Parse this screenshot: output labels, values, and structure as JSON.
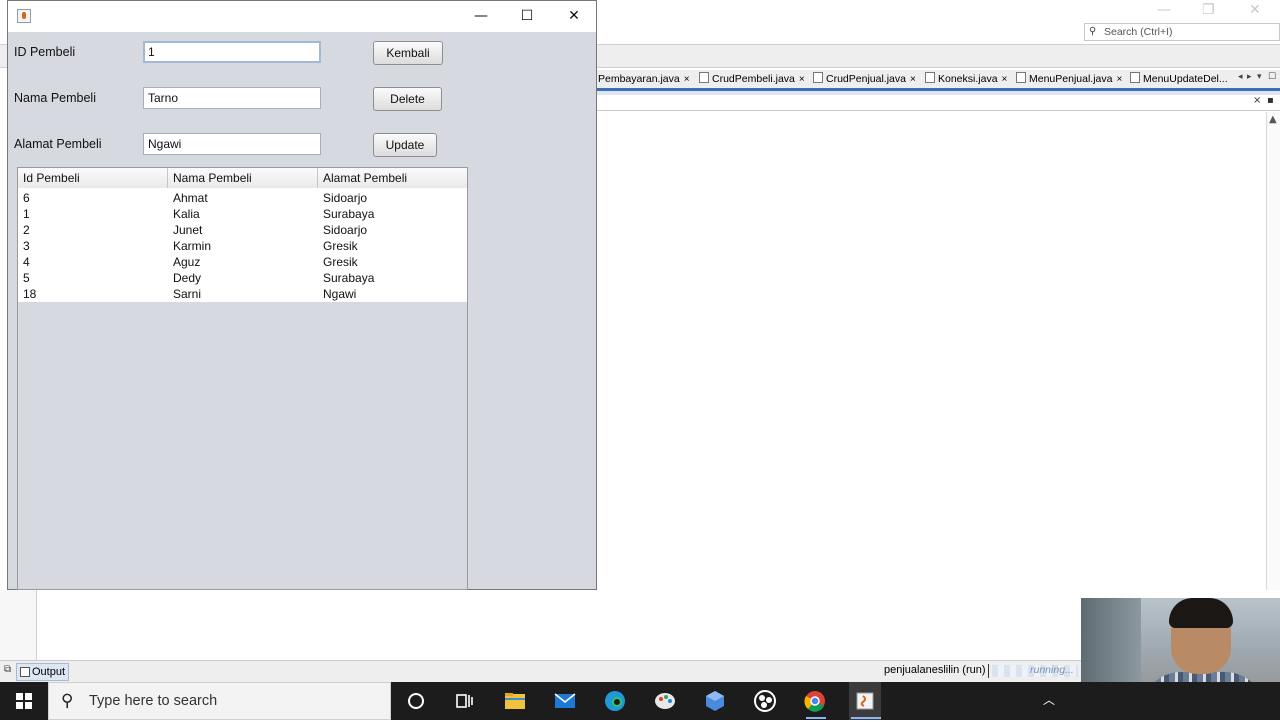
{
  "ide": {
    "search_placeholder": "Search (Ctrl+I)",
    "search_icon": "magnifier-icon",
    "tabs": [
      {
        "label": "Pembayaran.java"
      },
      {
        "label": "CrudPembeli.java"
      },
      {
        "label": "CrudPenjual.java"
      },
      {
        "label": "Koneksi.java"
      },
      {
        "label": "MenuPenjual.java"
      },
      {
        "label": "MenuUpdateDel..."
      }
    ],
    "tab_close": "×",
    "output_tab": "Output",
    "run_label": "penjualaneslilin (run)",
    "run_status": "running...",
    "accent": "#3a6fb7"
  },
  "app": {
    "window_controls": {
      "minimize": "—",
      "maximize": "☐",
      "close": "✕"
    },
    "form": {
      "id_label": "ID Pembeli",
      "id_value": "1",
      "nama_label": "Nama Pembeli",
      "nama_value": "Tarno",
      "alamat_label": "Alamat Pembeli",
      "alamat_value": "Ngawi"
    },
    "buttons": {
      "kembali": "Kembali",
      "delete": "Delete",
      "update": "Update"
    },
    "table": {
      "headers": [
        "Id Pembeli",
        "Nama Pembeli",
        "Alamat Pembeli"
      ],
      "rows": [
        [
          "6",
          "Ahmat",
          "Sidoarjo"
        ],
        [
          "1",
          "Kalia",
          "Surabaya"
        ],
        [
          "2",
          "Junet",
          "Sidoarjo"
        ],
        [
          "3",
          "Karmin",
          "Gresik"
        ],
        [
          "4",
          "Aguz",
          "Gresik"
        ],
        [
          "5",
          "Dedy",
          "Surabaya"
        ],
        [
          "18",
          "Sarni",
          "Ngawi"
        ]
      ]
    }
  },
  "taskbar": {
    "search_placeholder": "Type here to search",
    "icons": [
      "cortana-icon",
      "task-view-icon",
      "file-explorer-icon",
      "mail-icon",
      "edge-icon",
      "paint-icon",
      "app-cube-icon",
      "obs-icon",
      "chrome-icon",
      "java-icon"
    ]
  }
}
